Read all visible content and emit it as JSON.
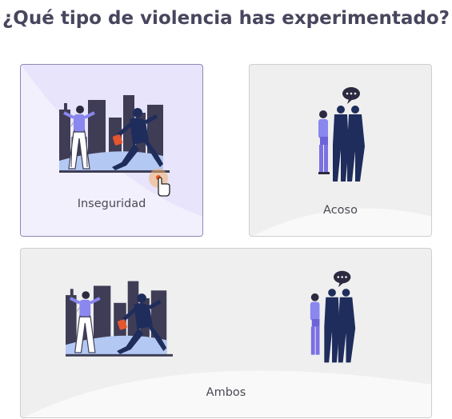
{
  "question": {
    "title": "¿Qué tipo de violencia has experimentado?"
  },
  "options": [
    {
      "label": "Inseguridad",
      "selected": true,
      "illustration": "robbery-scene-illustration"
    },
    {
      "label": "Acoso",
      "selected": false,
      "illustration": "harassment-scene-illustration"
    },
    {
      "label": "Ambos",
      "selected": false,
      "illustration": "robbery-and-harassment-illustration"
    }
  ],
  "colors": {
    "selected_bg": "#e7e4fb",
    "selected_border": "#8f89b5",
    "card_bg": "#efefef",
    "title": "#48465e",
    "navy": "#1f2d5c",
    "purple": "#6c63d8",
    "city": "#3f3d56"
  },
  "pointer": {
    "icon": "hand-cursor-icon"
  }
}
